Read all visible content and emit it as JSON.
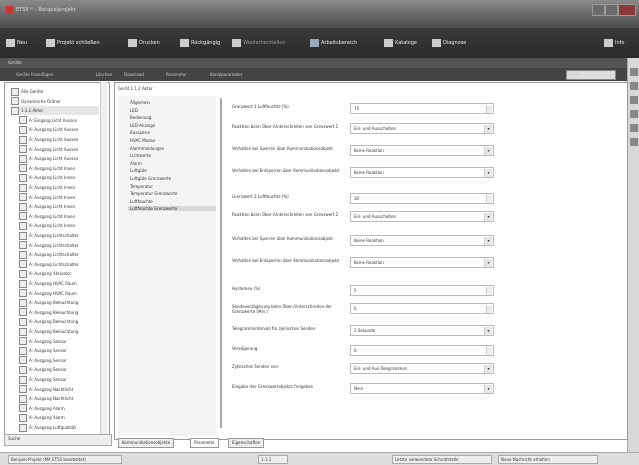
{
  "window": {
    "title": "ETS5™ - Beispielprojekt"
  },
  "toolbar": {
    "items": [
      {
        "label": "Neu"
      },
      {
        "label": "Projekt schließen"
      },
      {
        "label": "Drucken"
      },
      {
        "label": "Rückgängig"
      },
      {
        "label": "Wiederherstellen"
      },
      {
        "label": "Arbeitsbereich"
      },
      {
        "label": "Kataloge"
      },
      {
        "label": "Diagnose"
      }
    ],
    "right_label": "Info"
  },
  "panel": {
    "title": "Geräte",
    "actions": [
      "Geräte hinzufügen",
      "Löschen",
      "Download",
      "Parameter",
      "Kanalparameter"
    ],
    "search_placeholder": "Suchen"
  },
  "sidebar": {
    "items": [
      {
        "label": "Alle Geräte"
      },
      {
        "label": "Dynamische Ordner"
      },
      {
        "label": "1.1.2 Aktor"
      },
      {
        "label": "A: Eingang Licht Aussen"
      },
      {
        "label": "A: Ausgang Licht Aussen"
      },
      {
        "label": "A: Ausgang Licht Aussen"
      },
      {
        "label": "A: Ausgang Licht Aussen"
      },
      {
        "label": "A: Ausgang Licht Aussen"
      },
      {
        "label": "A: Ausgang Licht Innen"
      },
      {
        "label": "A: Ausgang Licht Innen"
      },
      {
        "label": "A: Ausgang Licht Innen"
      },
      {
        "label": "A: Ausgang Licht Innen"
      },
      {
        "label": "A: Ausgang Licht Innen"
      },
      {
        "label": "A: Ausgang Licht Innen"
      },
      {
        "label": "A: Ausgang Licht Innen"
      },
      {
        "label": "A: Ausgang Lichtschalter"
      },
      {
        "label": "A: Ausgang Lichtschalter"
      },
      {
        "label": "A: Ausgang Lichtschalter"
      },
      {
        "label": "A: Ausgang Lichtschalter"
      },
      {
        "label": "A: Ausgang Aktivator"
      },
      {
        "label": "A: Ausgang HVAC Raum"
      },
      {
        "label": "A: Ausgang HVAC Raum"
      },
      {
        "label": "A: Ausgang Beleuchtung"
      },
      {
        "label": "A: Ausgang Beleuchtung"
      },
      {
        "label": "A: Ausgang Beleuchtung"
      },
      {
        "label": "A: Ausgang Beleuchtung"
      },
      {
        "label": "A: Ausgang Sensor"
      },
      {
        "label": "A: Ausgang Sensor"
      },
      {
        "label": "A: Ausgang Sensor"
      },
      {
        "label": "A: Ausgang Sensor"
      },
      {
        "label": "A: Ausgang Sensor"
      },
      {
        "label": "A: Ausgang Nachtlicht"
      },
      {
        "label": "A: Ausgang Nachtlicht"
      },
      {
        "label": "A: Ausgang Alarm"
      },
      {
        "label": "A: Ausgang Alarm"
      },
      {
        "label": "A: Ausgang Luftqualität"
      }
    ],
    "footer": "Suche"
  },
  "breadcrumb": "Gerät 1.1.2 Aktor",
  "nav": {
    "items": [
      {
        "label": "Allgemein",
        "selected": false
      },
      {
        "label": "LED",
        "selected": false
      },
      {
        "label": "Bedienung",
        "selected": false
      },
      {
        "label": "LED-Anzeige",
        "selected": false
      },
      {
        "label": "Bussperre",
        "selected": false
      },
      {
        "label": "HVAC Modus",
        "selected": false
      },
      {
        "label": "Alarmmeldungen",
        "selected": false
      },
      {
        "label": "Lichtwerte",
        "selected": false
      },
      {
        "label": "Alarm",
        "selected": false
      },
      {
        "label": "Luftgüte",
        "selected": false
      },
      {
        "label": "Luftgüte Grenzwerte",
        "selected": false
      },
      {
        "label": "Temperatur",
        "selected": false
      },
      {
        "label": "Temperatur Grenzwerte",
        "selected": false
      },
      {
        "label": "Luftfeuchte",
        "selected": false
      },
      {
        "label": "Luftfeuchte Grenzwerte",
        "selected": true
      }
    ]
  },
  "form": {
    "rows": [
      {
        "label": "Grenzwert 1 Luftfeuchte (%)",
        "value": "70",
        "kind": "spin"
      },
      {
        "label": "Reaktion beim Über-/Unterschreiten von Grenzwert 1",
        "value": "Ein- und Ausschalten",
        "kind": "select"
      },
      {
        "label": "Verhalten bei Sperren über Kommunikationsobjekt",
        "value": "Keine Reaktion",
        "kind": "select"
      },
      {
        "label": "Verhalten bei Entsperren über Kommunikationsobjekt",
        "value": "Keine Reaktion",
        "kind": "select"
      },
      {
        "label": "Grenzwert 2 Luftfeuchte (%)",
        "value": "30",
        "kind": "spin"
      },
      {
        "label": "Reaktion beim Über-/Unterschreiten von Grenzwert 2",
        "value": "Ein- und Ausschalten",
        "kind": "select"
      },
      {
        "label": "Verhalten bei Sperren über Kommunikationsobjekt",
        "value": "Keine Reaktion",
        "kind": "select"
      },
      {
        "label": "Verhalten bei Entsperren über Kommunikationsobjekt",
        "value": "Keine Reaktion",
        "kind": "select"
      },
      {
        "label": "Hysterese (%)",
        "value": "5",
        "kind": "spin"
      },
      {
        "label": "Sendeverzögerung beim Über-/Unterschreiten der Grenzwerte (Min.)",
        "value": "0",
        "kind": "spin"
      },
      {
        "label": "Telegrammintervall für zyklisches Senden",
        "value": "1 Sekunde",
        "kind": "select"
      },
      {
        "label": "Verzögerung",
        "value": "0",
        "kind": "spin"
      },
      {
        "label": "Zyklisches Senden von",
        "value": "Ein- und Aus-Telegrammen",
        "kind": "select"
      },
      {
        "label": "Eingabe des Grenzwertobjekts freigeben",
        "value": "Nein",
        "kind": "select"
      }
    ]
  },
  "tabs": [
    {
      "label": "Kommunikationsobjekte",
      "active": false
    },
    {
      "label": "Parameter",
      "active": true
    },
    {
      "label": "Eigenschaften",
      "active": false
    }
  ],
  "status": {
    "cells": [
      "Beispiel-Projekt (Mit ETS5 bearbeitet)",
      "1.1.2",
      "Letzte verwendete Schnittstelle",
      "Neue Nachricht erhalten"
    ]
  }
}
